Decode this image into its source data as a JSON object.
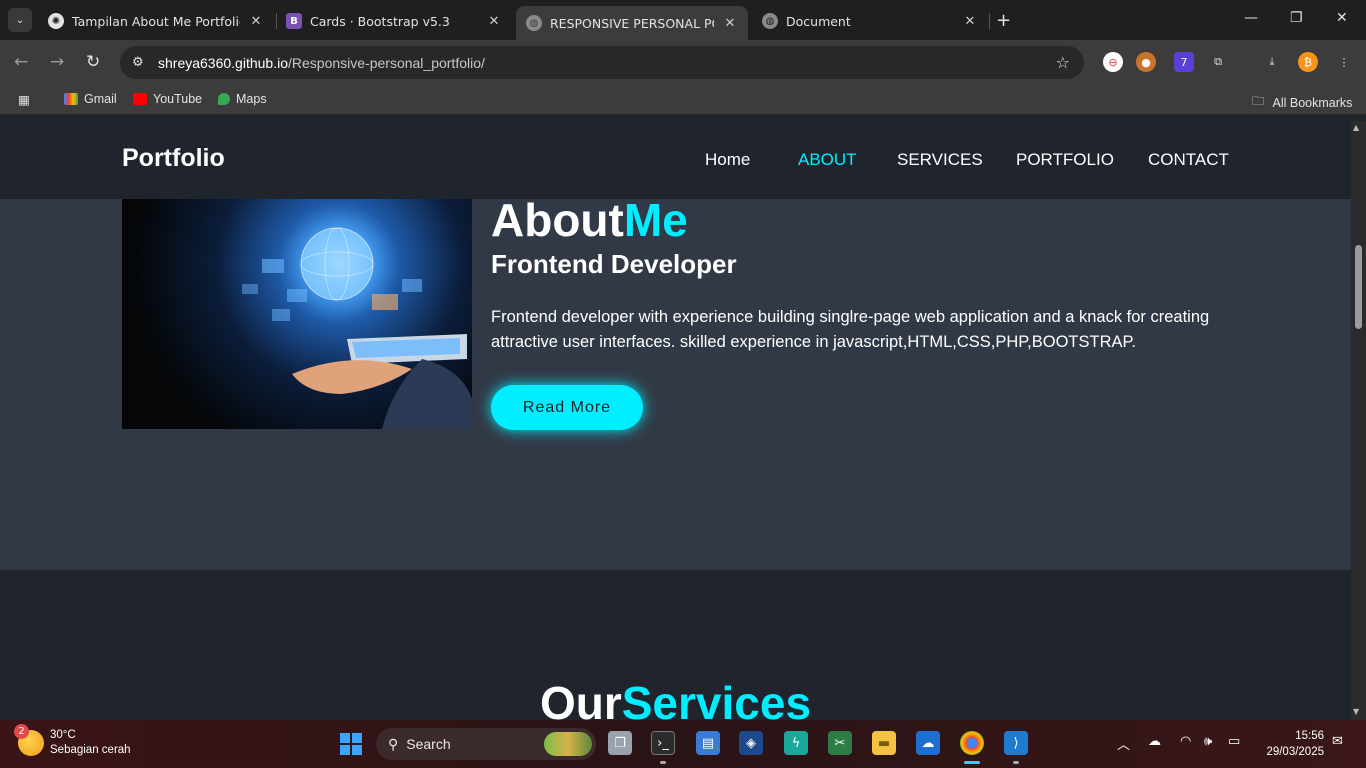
{
  "browser": {
    "tabs": [
      {
        "title": "Tampilan About Me Portfolio",
        "active": false
      },
      {
        "title": "Cards · Bootstrap v5.3",
        "active": false
      },
      {
        "title": "RESPONSIVE PERSONAL PORTF",
        "active": true
      },
      {
        "title": "Document",
        "active": false
      }
    ],
    "url_domain": "shreya6360.github.io",
    "url_path": "/Responsive-personal_portfolio/",
    "extension_badge": "7",
    "bookmarks": [
      "Gmail",
      "YouTube",
      "Maps"
    ],
    "all_bookmarks": "All Bookmarks"
  },
  "site": {
    "logo": "Portfolio",
    "nav": [
      "Home",
      "ABOUT",
      "SERVICES",
      "PORTFOLIO",
      "CONTACT"
    ],
    "active_nav": "ABOUT",
    "about": {
      "heading_white": "About",
      "heading_accent": "Me",
      "subheading": "Frontend Developer",
      "description": "Frontend developer with experience building singlre-page web application and a knack for creating attractive user interfaces. skilled experience in javascript,HTML,CSS,PHP,BOOTSTRAP.",
      "button": "Read More"
    },
    "services": {
      "heading_white": "Our",
      "heading_accent": "Services"
    },
    "accent_color": "#00eeff"
  },
  "taskbar": {
    "weather_badge": "2",
    "temperature": "30°C",
    "condition": "Sebagian cerah",
    "search_label": "Search",
    "time": "15:56",
    "date": "29/03/2025"
  }
}
